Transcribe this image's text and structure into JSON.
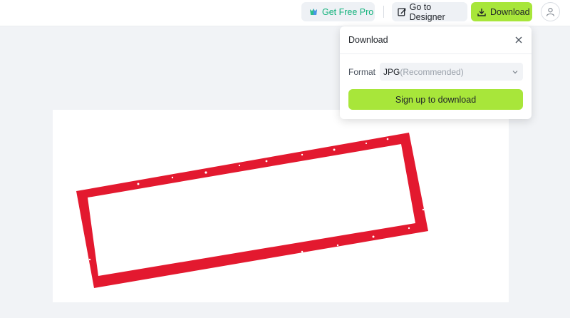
{
  "topbar": {
    "pro_label": "Get Free Pro",
    "designer_label": "Go to Designer",
    "download_label": "Download"
  },
  "popup": {
    "title": "Download",
    "format_label": "Format",
    "format_value": "JPG",
    "format_hint": "(Recommended)",
    "signup_label": "Sign up to download"
  },
  "colors": {
    "accent_green": "#a8e63a",
    "pro_text": "#13b27c",
    "stamp_red": "#e3192f",
    "background": "#f1f3f6"
  },
  "icons": {
    "pro": "crown-icon",
    "designer": "edit-icon",
    "download": "download-icon",
    "avatar": "user-icon",
    "close": "close-icon",
    "chevron": "chevron-down-icon"
  }
}
